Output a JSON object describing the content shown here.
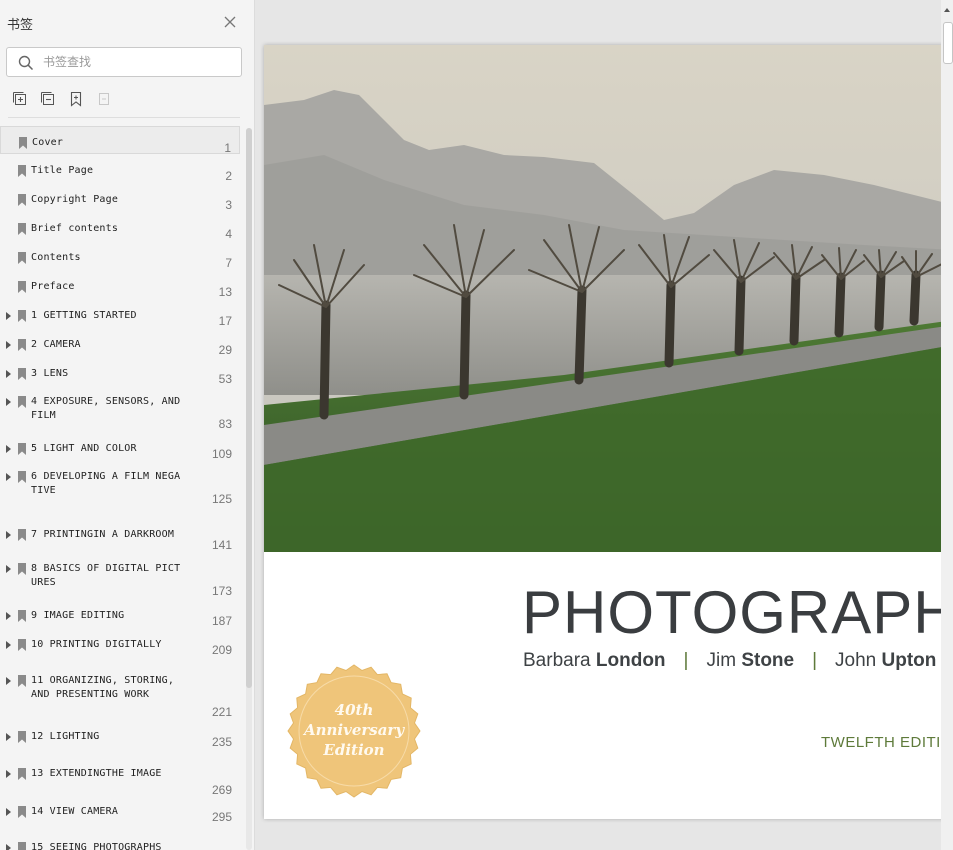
{
  "sidebar": {
    "title": "书签",
    "search_placeholder": "书签查找",
    "tools": [
      "expand-all-icon",
      "collapse-all-icon",
      "add-bookmark-icon",
      "delete-bookmark-icon"
    ],
    "items": [
      {
        "label": "Cover",
        "page": "1",
        "has_children": false,
        "selected": true
      },
      {
        "label": "Title Page",
        "page": "2",
        "has_children": false
      },
      {
        "label": "Copyright Page",
        "page": "3",
        "has_children": false
      },
      {
        "label": "Brief contents",
        "page": "4",
        "has_children": false
      },
      {
        "label": "Contents",
        "page": "7",
        "has_children": false
      },
      {
        "label": "Preface",
        "page": "13",
        "has_children": false
      },
      {
        "label": "1 GETTING STARTED",
        "page": "17",
        "has_children": true
      },
      {
        "label": "2 CAMERA",
        "page": "29",
        "has_children": true
      },
      {
        "label": "3 LENS",
        "page": "53",
        "has_children": true
      },
      {
        "label": "4 EXPOSURE, SENSORS, AND FILM",
        "page": "83",
        "has_children": true
      },
      {
        "label": "5 LIGHT AND COLOR",
        "page": "109",
        "has_children": true
      },
      {
        "label": "6 DEVELOPING A FILM NEGA TIVE",
        "page": "125",
        "has_children": true
      },
      {
        "label": "7 PRINTINGIN A DARKROOM",
        "page": "141",
        "has_children": true
      },
      {
        "label": "8 BASICS OF DIGITAL PICT URES",
        "page": "173",
        "has_children": true
      },
      {
        "label": "9 IMAGE EDITING",
        "page": "187",
        "has_children": true
      },
      {
        "label": "10 PRINTING DIGITALLY",
        "page": "209",
        "has_children": true
      },
      {
        "label": "11 ORGANIZING, STORING, AND PRESENTING WORK",
        "page": "221",
        "has_children": true
      },
      {
        "label": "12 LIGHTING",
        "page": "235",
        "has_children": true
      },
      {
        "label": "13 EXTENDINGTHE IMAGE",
        "page": "269",
        "has_children": true
      },
      {
        "label": "14 VIEW CAMERA",
        "page": "295",
        "has_children": true
      },
      {
        "label": "15 SEEING PHOTOGRAPHS",
        "page": "",
        "has_children": true
      }
    ]
  },
  "cover": {
    "title": "PHOTOGRAPHY",
    "authors": [
      {
        "first": "Barbara",
        "last": "London"
      },
      {
        "first": "Jim",
        "last": "Stone"
      },
      {
        "first": "John",
        "last": "Upton"
      }
    ],
    "author_separator": "|",
    "edition": "TWELFTH EDITION",
    "seal_lines": [
      "40th",
      "Anniversary",
      "Edition"
    ],
    "colors": {
      "title": "#3a3d40",
      "accent_green": "#5e7a3a",
      "seal_gold": "#efc57a"
    }
  }
}
